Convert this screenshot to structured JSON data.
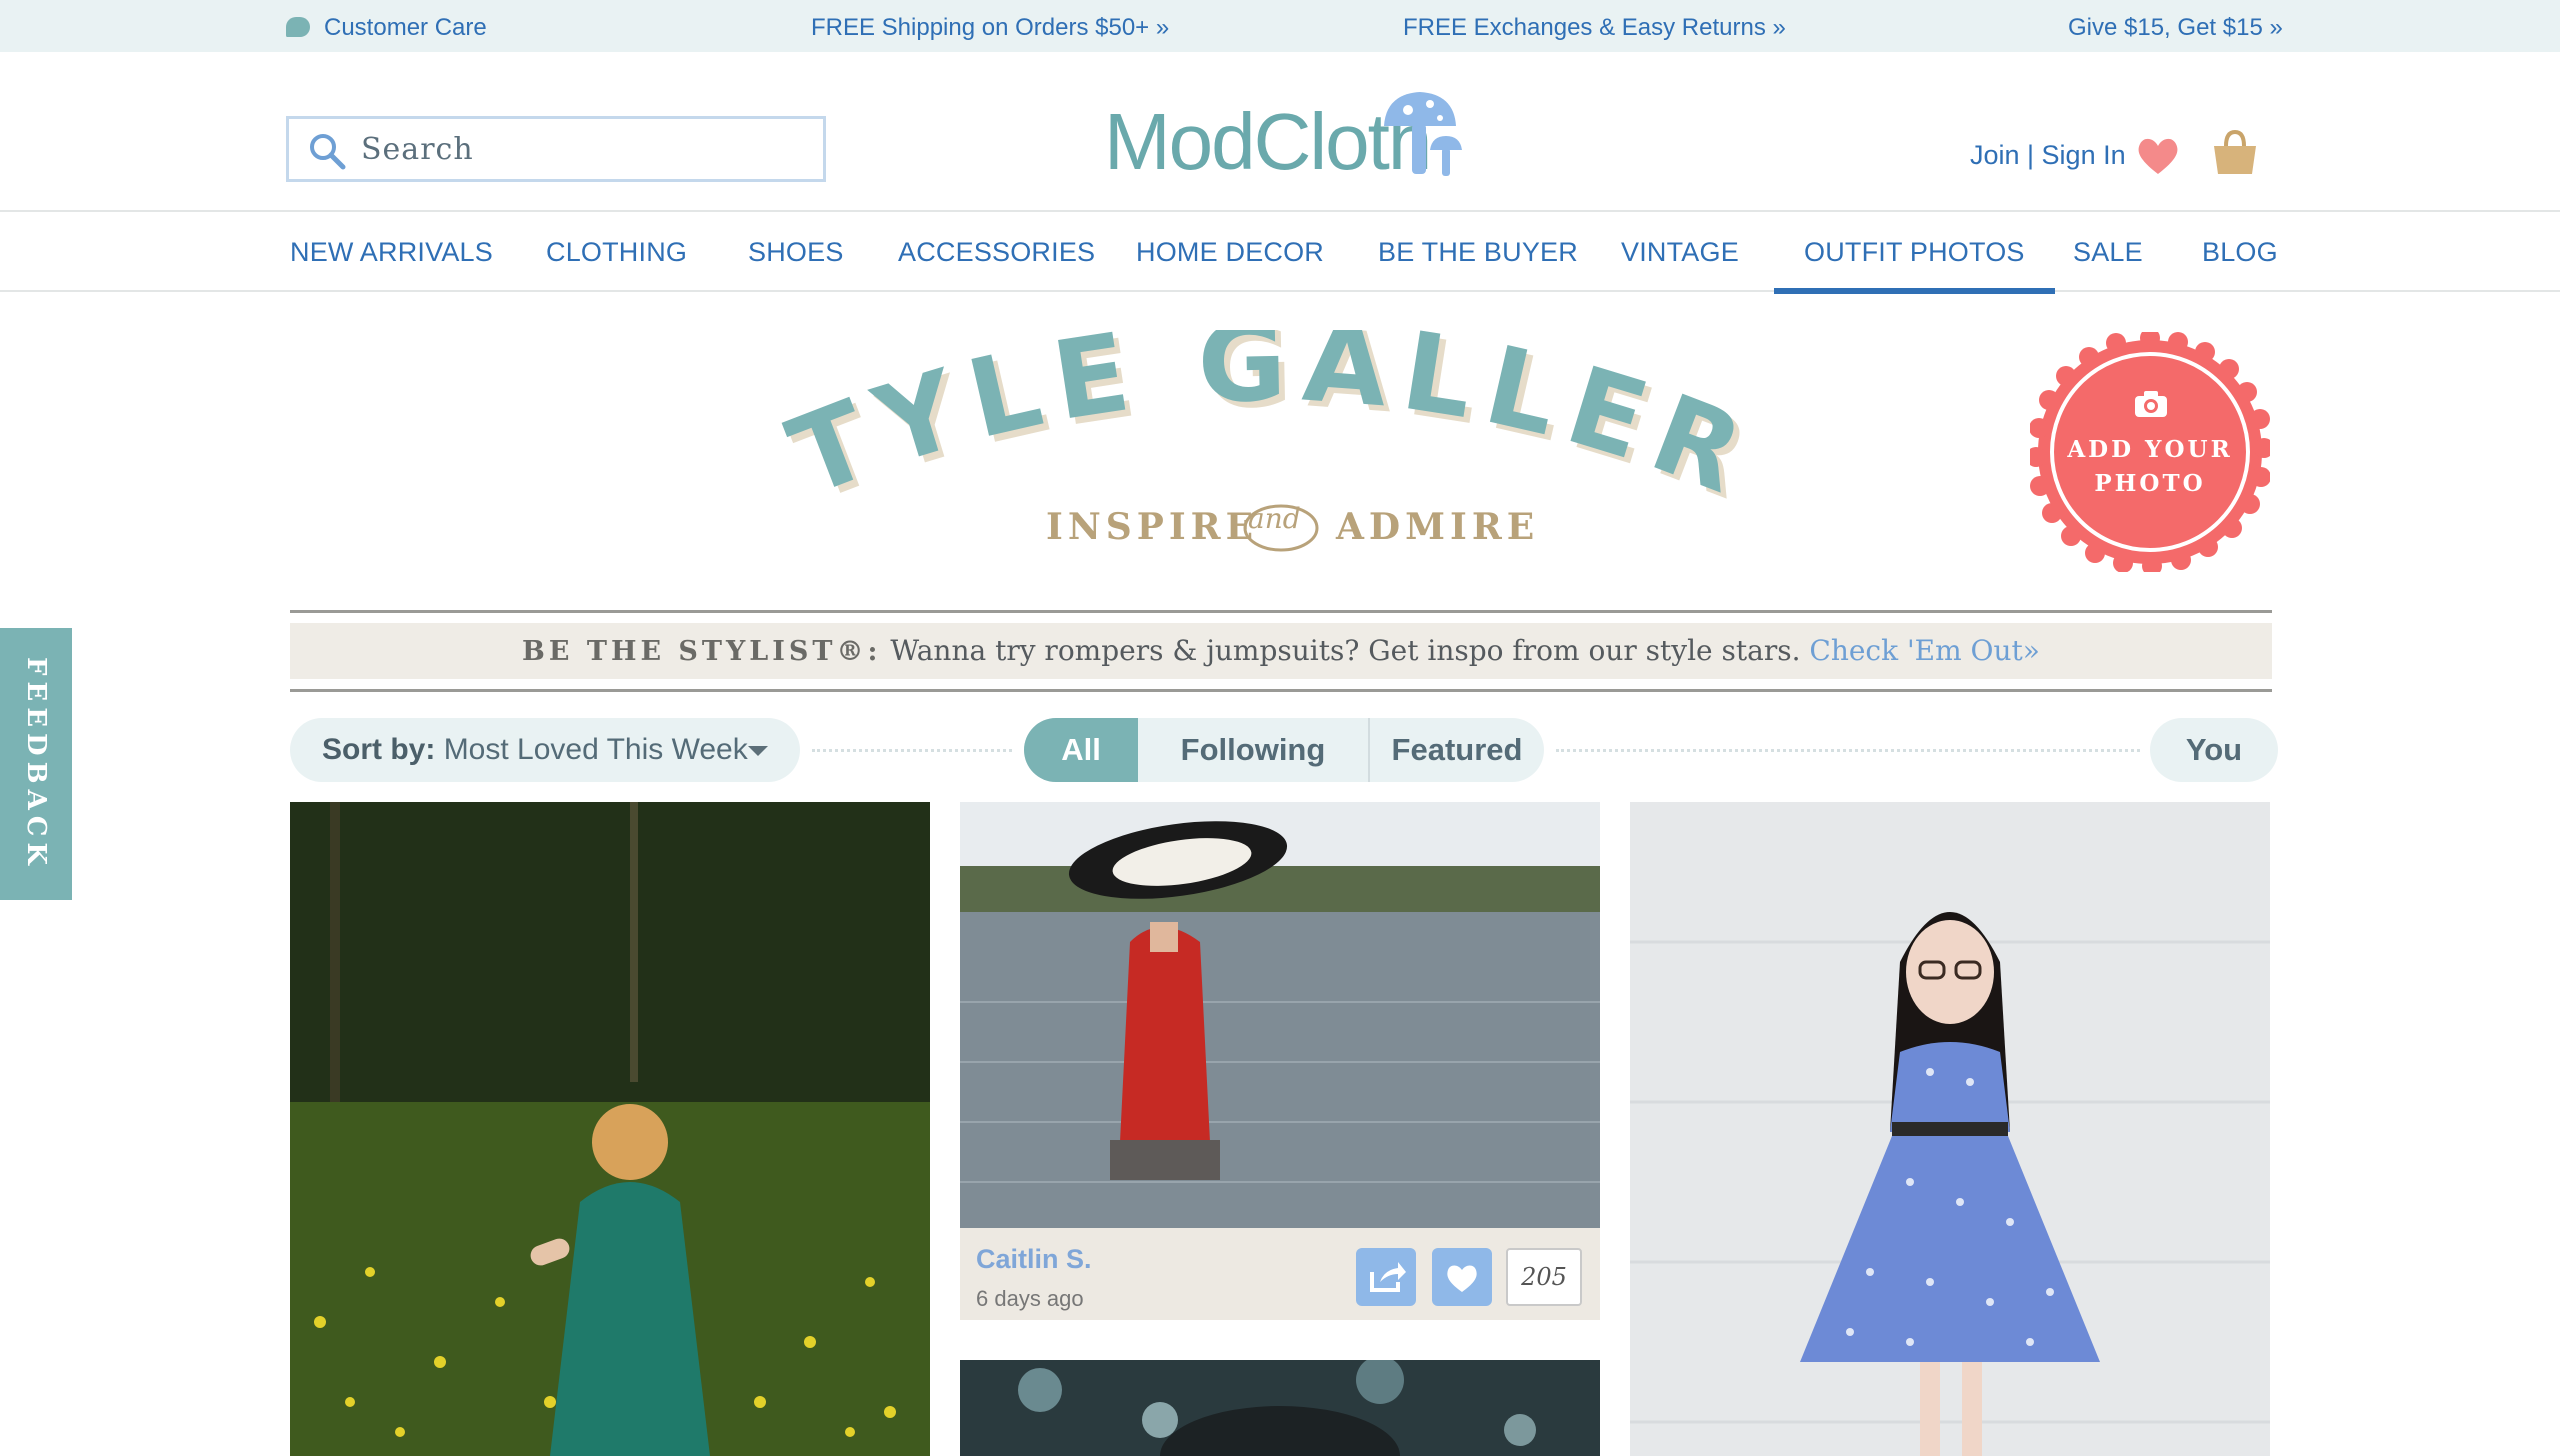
{
  "topbar": {
    "customer_care": "Customer Care",
    "shipping": "FREE Shipping on Orders $50+ »",
    "exchanges": "FREE Exchanges & Easy Returns »",
    "referral": "Give $15, Get $15 »"
  },
  "header": {
    "search_placeholder": "Search",
    "logo_text": "ModCloth",
    "join_signin": "Join | Sign In"
  },
  "nav": {
    "items": [
      "NEW ARRIVALS",
      "CLOTHING",
      "SHOES",
      "ACCESSORIES",
      "HOME DECOR",
      "BE THE BUYER",
      "VINTAGE",
      "OUTFIT PHOTOS",
      "SALE",
      "BLOG"
    ],
    "active": "OUTFIT PHOTOS"
  },
  "gallery": {
    "title": "STYLE GALLERY",
    "subtitle_left": "INSPIRE",
    "subtitle_and": "and",
    "subtitle_right": "ADMIRE",
    "badge_line1": "ADD YOUR",
    "badge_line2": "PHOTO"
  },
  "banner": {
    "label": "BE THE STYLIST®:",
    "text": "Wanna try rompers & jumpsuits? Get inspo from our style stars.",
    "link": "Check 'Em Out»"
  },
  "filters": {
    "sort_label": "Sort by:",
    "sort_value": "Most Loved This Week",
    "tabs": [
      "All",
      "Following",
      "Featured"
    ],
    "active_tab": "All",
    "you": "You"
  },
  "feedback": "FEEDBACK",
  "cards": [
    {
      "author": "Caitlin S.",
      "age": "6 days ago",
      "likes": "205"
    }
  ],
  "colors": {
    "link_blue": "#2f6fb5",
    "teal": "#7bb3b4",
    "badge_coral": "#f46a6a",
    "banner_bg": "#efece6"
  }
}
